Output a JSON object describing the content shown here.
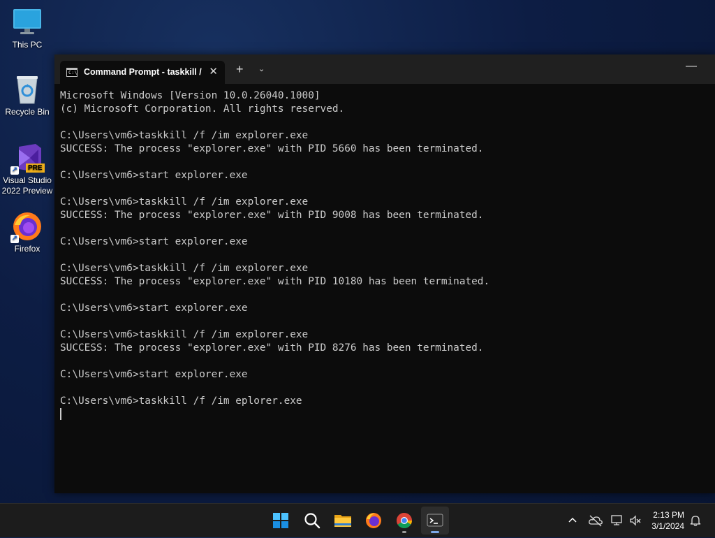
{
  "desktop": {
    "icons": [
      {
        "label": "This PC"
      },
      {
        "label": "Recycle Bin"
      },
      {
        "label": "Visual Studio 2022 Preview",
        "badge": "PRE"
      },
      {
        "label": "Firefox"
      }
    ]
  },
  "window": {
    "tab_title": "Command Prompt - taskkill  /",
    "tab_close": "✕",
    "new_tab": "+",
    "dropdown": "⌄",
    "minimize": "—",
    "tab_icon_text": "C:\\"
  },
  "console": {
    "text": "Microsoft Windows [Version 10.0.26040.1000]\n(c) Microsoft Corporation. All rights reserved.\n\nC:\\Users\\vm6>taskkill /f /im explorer.exe\nSUCCESS: The process \"explorer.exe\" with PID 5660 has been terminated.\n\nC:\\Users\\vm6>start explorer.exe\n\nC:\\Users\\vm6>taskkill /f /im explorer.exe\nSUCCESS: The process \"explorer.exe\" with PID 9008 has been terminated.\n\nC:\\Users\\vm6>start explorer.exe\n\nC:\\Users\\vm6>taskkill /f /im explorer.exe\nSUCCESS: The process \"explorer.exe\" with PID 10180 has been terminated.\n\nC:\\Users\\vm6>start explorer.exe\n\nC:\\Users\\vm6>taskkill /f /im explorer.exe\nSUCCESS: The process \"explorer.exe\" with PID 8276 has been terminated.\n\nC:\\Users\\vm6>start explorer.exe\n\nC:\\Users\\vm6>taskkill /f /im eplorer.exe\n"
  },
  "taskbar": {
    "apps": [
      "start-icon",
      "search-icon",
      "file-explorer-icon",
      "firefox-icon",
      "chrome-icon",
      "terminal-icon"
    ],
    "time": "2:13 PM",
    "date": "3/1/2024",
    "accent": "#7ea8e8"
  }
}
